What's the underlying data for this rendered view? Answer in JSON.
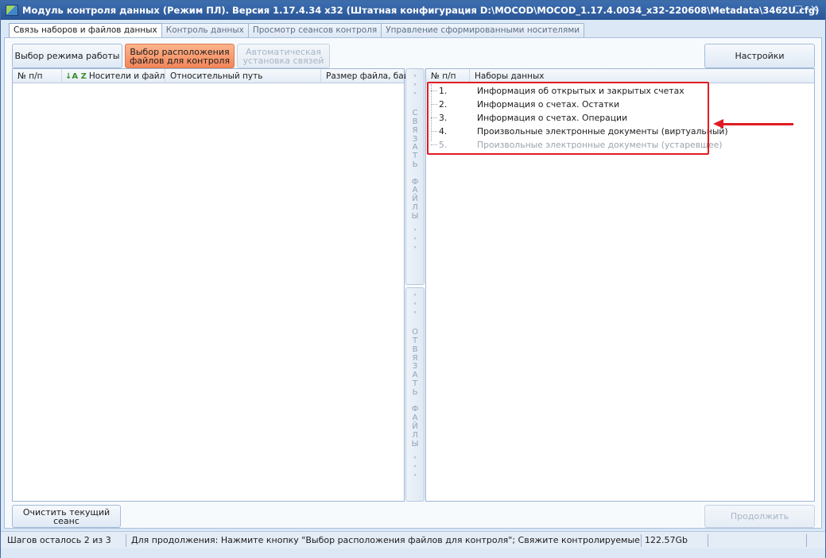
{
  "window": {
    "title": "Модуль контроля данных (Режим ПЛ). Версия 1.17.4.34 x32 (Штатная конфигурация D:\\MOCOD\\MOCOD_1.17.4.0034_x32-220608\\Metadata\\3462U.cfg)",
    "minimize": "–",
    "maximize": "□",
    "close": "✕"
  },
  "tabs": [
    {
      "label": "Связь наборов и файлов данных",
      "active": true
    },
    {
      "label": "Контроль данных"
    },
    {
      "label": "Просмотр сеансов контроля"
    },
    {
      "label": "Управление сформированными носителями"
    }
  ],
  "toolbar": {
    "mode_label": "Выбор режима работы",
    "location_label_1": "Выбор расположения",
    "location_label_2": "файлов для контроля",
    "auto_label_1": "Автоматическая",
    "auto_label_2": "установка связей",
    "settings_label": "Настройки"
  },
  "files_grid": {
    "columns": [
      "№ п/п",
      "Носители и файлы",
      "Относительный путь",
      "Размер файла, байт"
    ],
    "sort_icon": "↓A Z"
  },
  "linker": {
    "link_label": [
      "˃",
      "˃",
      "˃",
      "",
      "С",
      "В",
      "Я",
      "З",
      "А",
      "Т",
      "Ь",
      "",
      "Ф",
      "А",
      "Й",
      "Л",
      "Ы",
      "",
      "˃",
      "˃",
      "˃"
    ],
    "unlink_label": [
      "˂",
      "˂",
      "˂",
      "",
      "О",
      "Т",
      "В",
      "Я",
      "З",
      "А",
      "Т",
      "Ь",
      "",
      "Ф",
      "А",
      "Й",
      "Л",
      "Ы",
      "",
      "˂",
      "˂",
      "˂"
    ]
  },
  "datasets_grid": {
    "columns": [
      "№ п/п",
      "Наборы данных"
    ],
    "rows": [
      {
        "num": "1.",
        "name": "Информация об открытых и закрытых счетах"
      },
      {
        "num": "2.",
        "name": "Информация о счетах. Остатки"
      },
      {
        "num": "3.",
        "name": "Информация о счетах. Операции"
      },
      {
        "num": "4.",
        "name": "Произвольные электронные документы (виртуальный)"
      },
      {
        "num": "5.",
        "name": "Произвольные электронные документы (устаревшее)"
      }
    ]
  },
  "bottom": {
    "clear_label": "Очистить текущий сеанс",
    "continue_label": "Продолжить"
  },
  "status": {
    "steps": "Шагов осталось 2 из 3",
    "hint": "Для продолжения: Нажмите кнопку \"Выбор расположения файлов для контроля\"; Свяжите контролируемые файлы из ле",
    "disk": "122.57Gb"
  },
  "colors": {
    "accent_orange": "#f2865a",
    "highlight_red": "#e11b22",
    "titlebar_blue": "#2a5597"
  }
}
